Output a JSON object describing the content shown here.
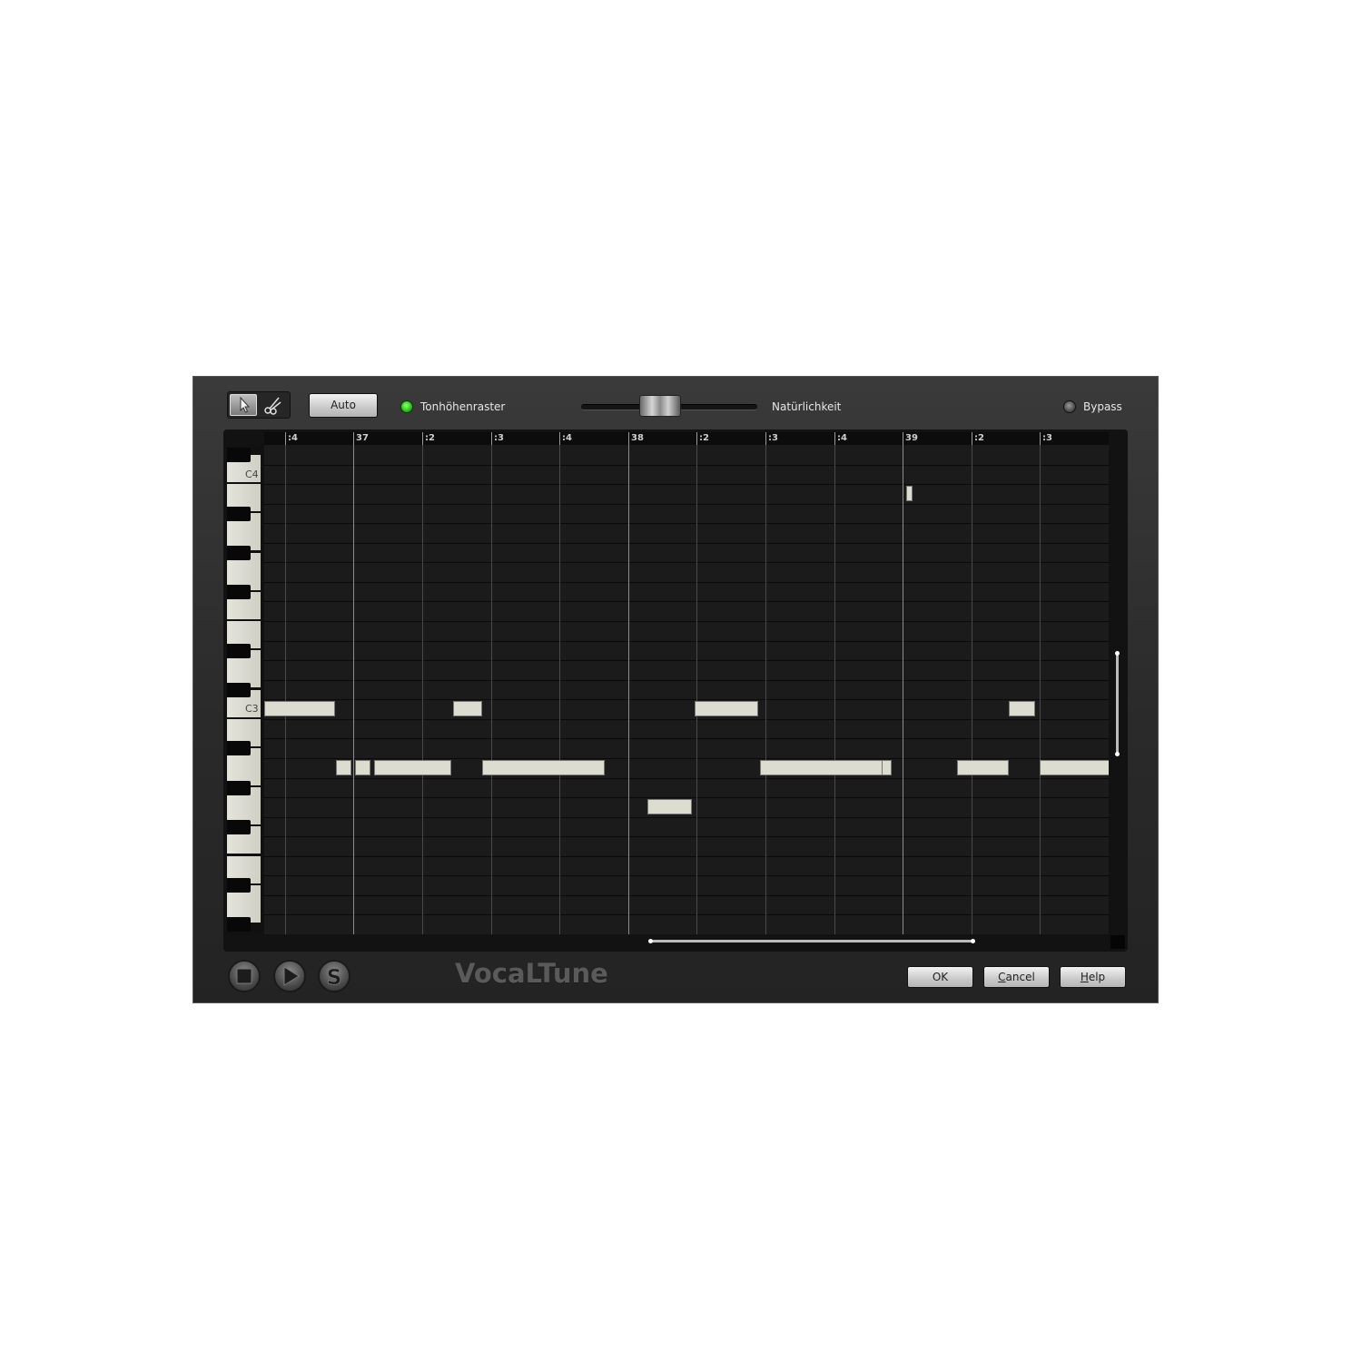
{
  "app": {
    "logo": "VocaLTune"
  },
  "toolbar": {
    "tools": [
      {
        "name": "pointer-tool",
        "active": true
      },
      {
        "name": "scissors-tool",
        "active": false
      }
    ],
    "auto_label": "Auto",
    "pitch_grid_label": "Tonhöhenraster",
    "pitch_grid_on": true,
    "naturalness_label": "Natürlichkeit",
    "naturalness_value": 0.45,
    "bypass_label": "Bypass",
    "bypass_on": false
  },
  "ruler": {
    "beats_per_bar": 4,
    "view_start_beat": 3.7,
    "beats_visible": 12.3,
    "marks": [
      {
        "beat": 4,
        "label": ":4"
      },
      {
        "beat": 5,
        "label": "37"
      },
      {
        "beat": 6,
        "label": ":2"
      },
      {
        "beat": 7,
        "label": ":3"
      },
      {
        "beat": 8,
        "label": ":4"
      },
      {
        "beat": 9,
        "label": "38"
      },
      {
        "beat": 10,
        "label": ":2"
      },
      {
        "beat": 11,
        "label": ":3"
      },
      {
        "beat": 12,
        "label": ":4"
      },
      {
        "beat": 13,
        "label": "39"
      },
      {
        "beat": 14,
        "label": ":2"
      },
      {
        "beat": 15,
        "label": ":3"
      }
    ]
  },
  "keyboard": {
    "top_pitch": 73,
    "row_count": 25,
    "octave_labels": [
      {
        "pitch": 72,
        "label": "C4"
      },
      {
        "pitch": 60,
        "label": "C3"
      }
    ]
  },
  "notes": [
    {
      "pitch": 60,
      "start": 3.7,
      "length": 1.03,
      "selected": false
    },
    {
      "pitch": 60,
      "start": 6.45,
      "length": 0.42,
      "selected": false
    },
    {
      "pitch": 60,
      "start": 9.97,
      "length": 0.93,
      "selected": false
    },
    {
      "pitch": 60,
      "start": 14.55,
      "length": 0.38,
      "selected": false
    },
    {
      "pitch": 57,
      "start": 4.75,
      "length": 0.22,
      "selected": false
    },
    {
      "pitch": 57,
      "start": 5.02,
      "length": 0.22,
      "selected": false
    },
    {
      "pitch": 57,
      "start": 5.3,
      "length": 1.12,
      "selected": false
    },
    {
      "pitch": 57,
      "start": 6.88,
      "length": 1.78,
      "selected": false
    },
    {
      "pitch": 57,
      "start": 10.92,
      "length": 1.78,
      "selected": false
    },
    {
      "pitch": 57,
      "start": 12.7,
      "length": 0.15,
      "selected": false
    },
    {
      "pitch": 57,
      "start": 13.79,
      "length": 0.75,
      "selected": false
    },
    {
      "pitch": 57,
      "start": 15.0,
      "length": 1.06,
      "selected": false
    },
    {
      "pitch": 55,
      "start": 9.28,
      "length": 0.65,
      "selected": false
    },
    {
      "pitch": 71,
      "start": 13.05,
      "length": 0.09,
      "selected": false
    }
  ],
  "footer": {
    "ok_label": "OK",
    "cancel_first": "C",
    "cancel_rest": "ancel",
    "help_first": "H",
    "help_rest": "elp",
    "solo_glyph": "S"
  }
}
